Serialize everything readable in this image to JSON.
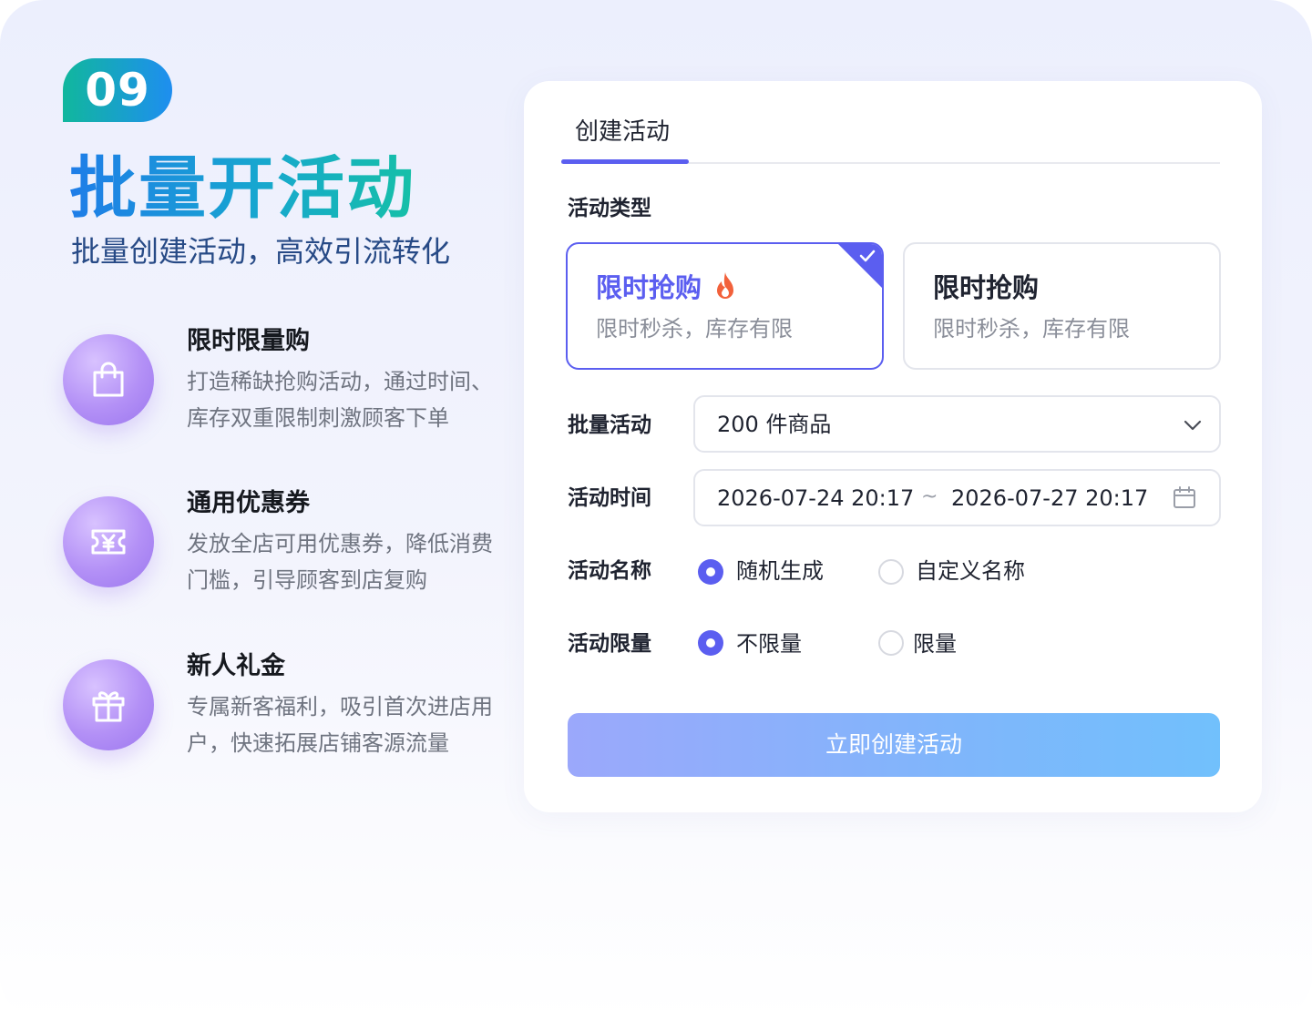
{
  "badge": "09",
  "hero": {
    "title": "批量开活动",
    "subtitle": "批量创建活动，高效引流转化"
  },
  "features": [
    {
      "icon": "shopping-bag-icon",
      "title": "限时限量购",
      "desc_line1": "打造稀缺抢购活动，通过时间、",
      "desc_line2": "库存双重限制刺激顾客下单"
    },
    {
      "icon": "coupon-yen-icon",
      "title": "通用优惠券",
      "desc_line1": "发放全店可用优惠券，降低消费",
      "desc_line2": "门槛，引导顾客到店复购"
    },
    {
      "icon": "gift-icon",
      "title": "新人礼金",
      "desc_line1": "专属新客福利，吸引首次进店用",
      "desc_line2": "户，快速拓展店铺客源流量"
    }
  ],
  "form": {
    "tab": "创建活动",
    "type_label": "活动类型",
    "type_options": [
      {
        "title": "限时抢购",
        "desc": "限时秒杀，库存有限",
        "selected": true,
        "icon": "fire-icon"
      },
      {
        "title": "限时抢购",
        "desc": "限时秒杀，库存有限",
        "selected": false
      }
    ],
    "batch_label": "批量活动",
    "batch_value": "200 件商品",
    "time_label": "活动时间",
    "time_start": "2026-07-24 20:17",
    "time_sep": "~",
    "time_end": "2026-07-27 20:17",
    "name_label": "活动名称",
    "name_options": [
      "随机生成",
      "自定义名称"
    ],
    "name_selected": "随机生成",
    "limit_label": "活动限量",
    "limit_options": [
      "不限量",
      "限量"
    ],
    "limit_selected": "不限量",
    "submit": "立即创建活动"
  },
  "colors": {
    "accent": "#5b5ef0",
    "badge_gradient": [
      "#11b79d",
      "#1e8ef0"
    ],
    "icon_circle": "#b390f6",
    "fire": "#f2613b"
  }
}
